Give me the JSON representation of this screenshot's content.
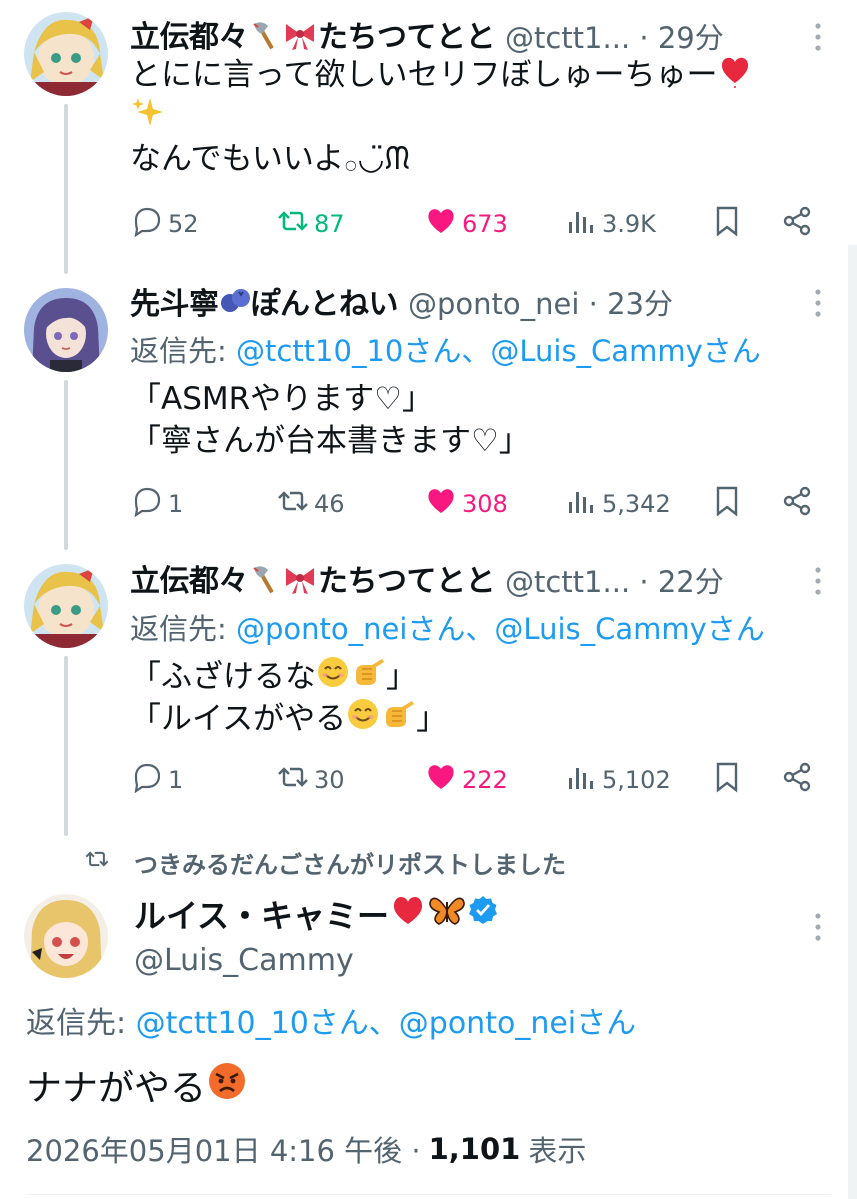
{
  "tweets": [
    {
      "display_name": "立伝都々",
      "display_name_suffix": "たちつてとと",
      "handle_time": "@tctt1... · 29分",
      "reply_to": null,
      "text_lines": [
        "とにに言って欲しいセリフぼしゅーちゅー",
        "",
        "なんでもいいよ𓂂◡̈ᙏ"
      ],
      "actions": {
        "reply": "52",
        "retweet": "87",
        "like": "673",
        "views": "3.9K"
      }
    },
    {
      "display_name": "先斗寧",
      "display_name_suffix": "ぽんとねい",
      "handle_time": "@ponto_nei · 23分",
      "reply_prefix": "返信先: ",
      "reply_mentions": "@tctt10_10さん、@Luis_Cammyさん",
      "text_lines": [
        "「ASMRやります♡」",
        "「寧さんが台本書きます♡」"
      ],
      "actions": {
        "reply": "1",
        "retweet": "46",
        "like": "308",
        "views": "5,342"
      }
    },
    {
      "display_name": "立伝都々",
      "display_name_suffix": "たちつてとと",
      "handle_time": "@tctt1... · 22分",
      "reply_prefix": "返信先: ",
      "reply_mentions": "@ponto_neiさん、@Luis_Cammyさん",
      "text_lines": [
        "「ふざけるな",
        "」",
        "「ルイスがやる",
        "」"
      ],
      "actions": {
        "reply": "1",
        "retweet": "30",
        "like": "222",
        "views": "5,102"
      }
    }
  ],
  "repost_notice": "つきみるだんごさんがリポストしました",
  "main_tweet": {
    "display_name": "ルイス・キャミー",
    "handle": "@Luis_Cammy",
    "reply_prefix": "返信先: ",
    "reply_mentions": "@tctt10_10さん、@ponto_neiさん",
    "text": "ナナがやる",
    "date": "2026年05月01日 4:16 午後 ·",
    "views_count": "1,101",
    "views_label": "表示"
  },
  "colors": {
    "text": "#0f1419",
    "muted": "#536471",
    "link": "#1d9bf0",
    "like": "#f91880",
    "retweet": "#00ba7c",
    "verified": "#1d9bf0"
  },
  "icons": [
    "reply-icon",
    "retweet-icon",
    "like-icon",
    "views-icon",
    "bookmark-icon",
    "share-icon",
    "more-icon",
    "verified-icon",
    "axe-emoji",
    "ribbon-emoji",
    "blueberry-emoji",
    "heart-emoji",
    "sparkles-emoji",
    "smile-emoji",
    "pointing-hand-emoji",
    "butterfly-emoji",
    "angry-face-emoji"
  ]
}
